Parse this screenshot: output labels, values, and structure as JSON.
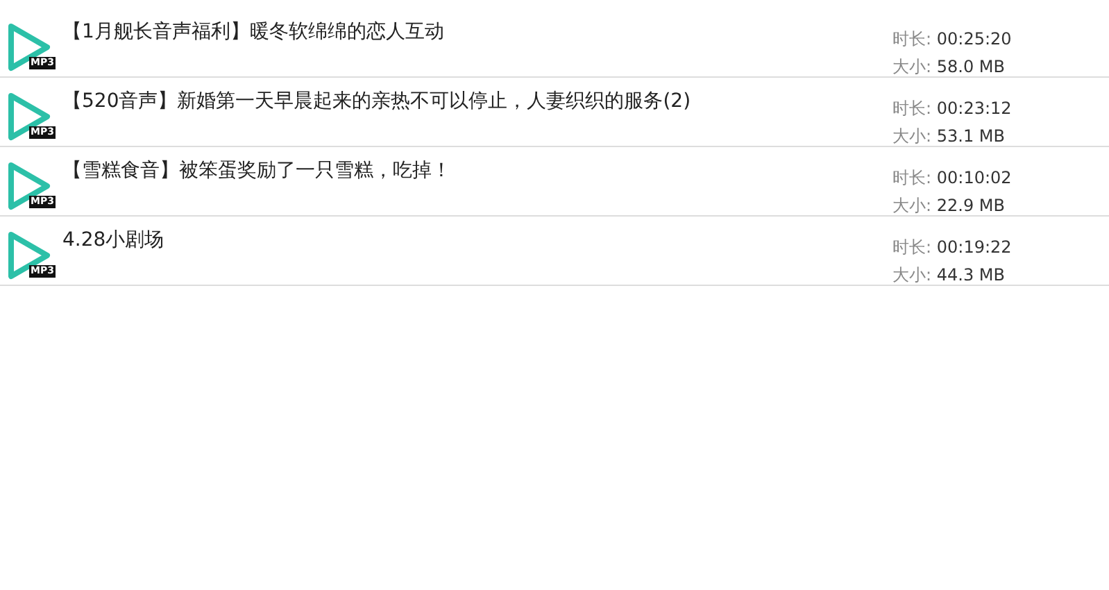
{
  "tracks": [
    {
      "title": "【1月舰长音声福利】暖冬软绵绵的恋人互动",
      "badge": "MP3",
      "duration_label": "时长:",
      "duration": "00:25:20",
      "size_label": "大小:",
      "size": "58.0 MB"
    },
    {
      "title": "【520音声】新婚第一天早晨起来的亲热不可以停止，人妻织织的服务(2)",
      "badge": "MP3",
      "duration_label": "时长:",
      "duration": "00:23:12",
      "size_label": "大小:",
      "size": "53.1 MB"
    },
    {
      "title": "【雪糕食音】被笨蛋奖励了一只雪糕，吃掉！",
      "badge": "MP3",
      "duration_label": "时长:",
      "duration": "00:10:02",
      "size_label": "大小:",
      "size": "22.9 MB"
    },
    {
      "title": "4.28小剧场",
      "badge": "MP3",
      "duration_label": "时长:",
      "duration": "00:19:22",
      "size_label": "大小:",
      "size": "44.3 MB"
    }
  ]
}
